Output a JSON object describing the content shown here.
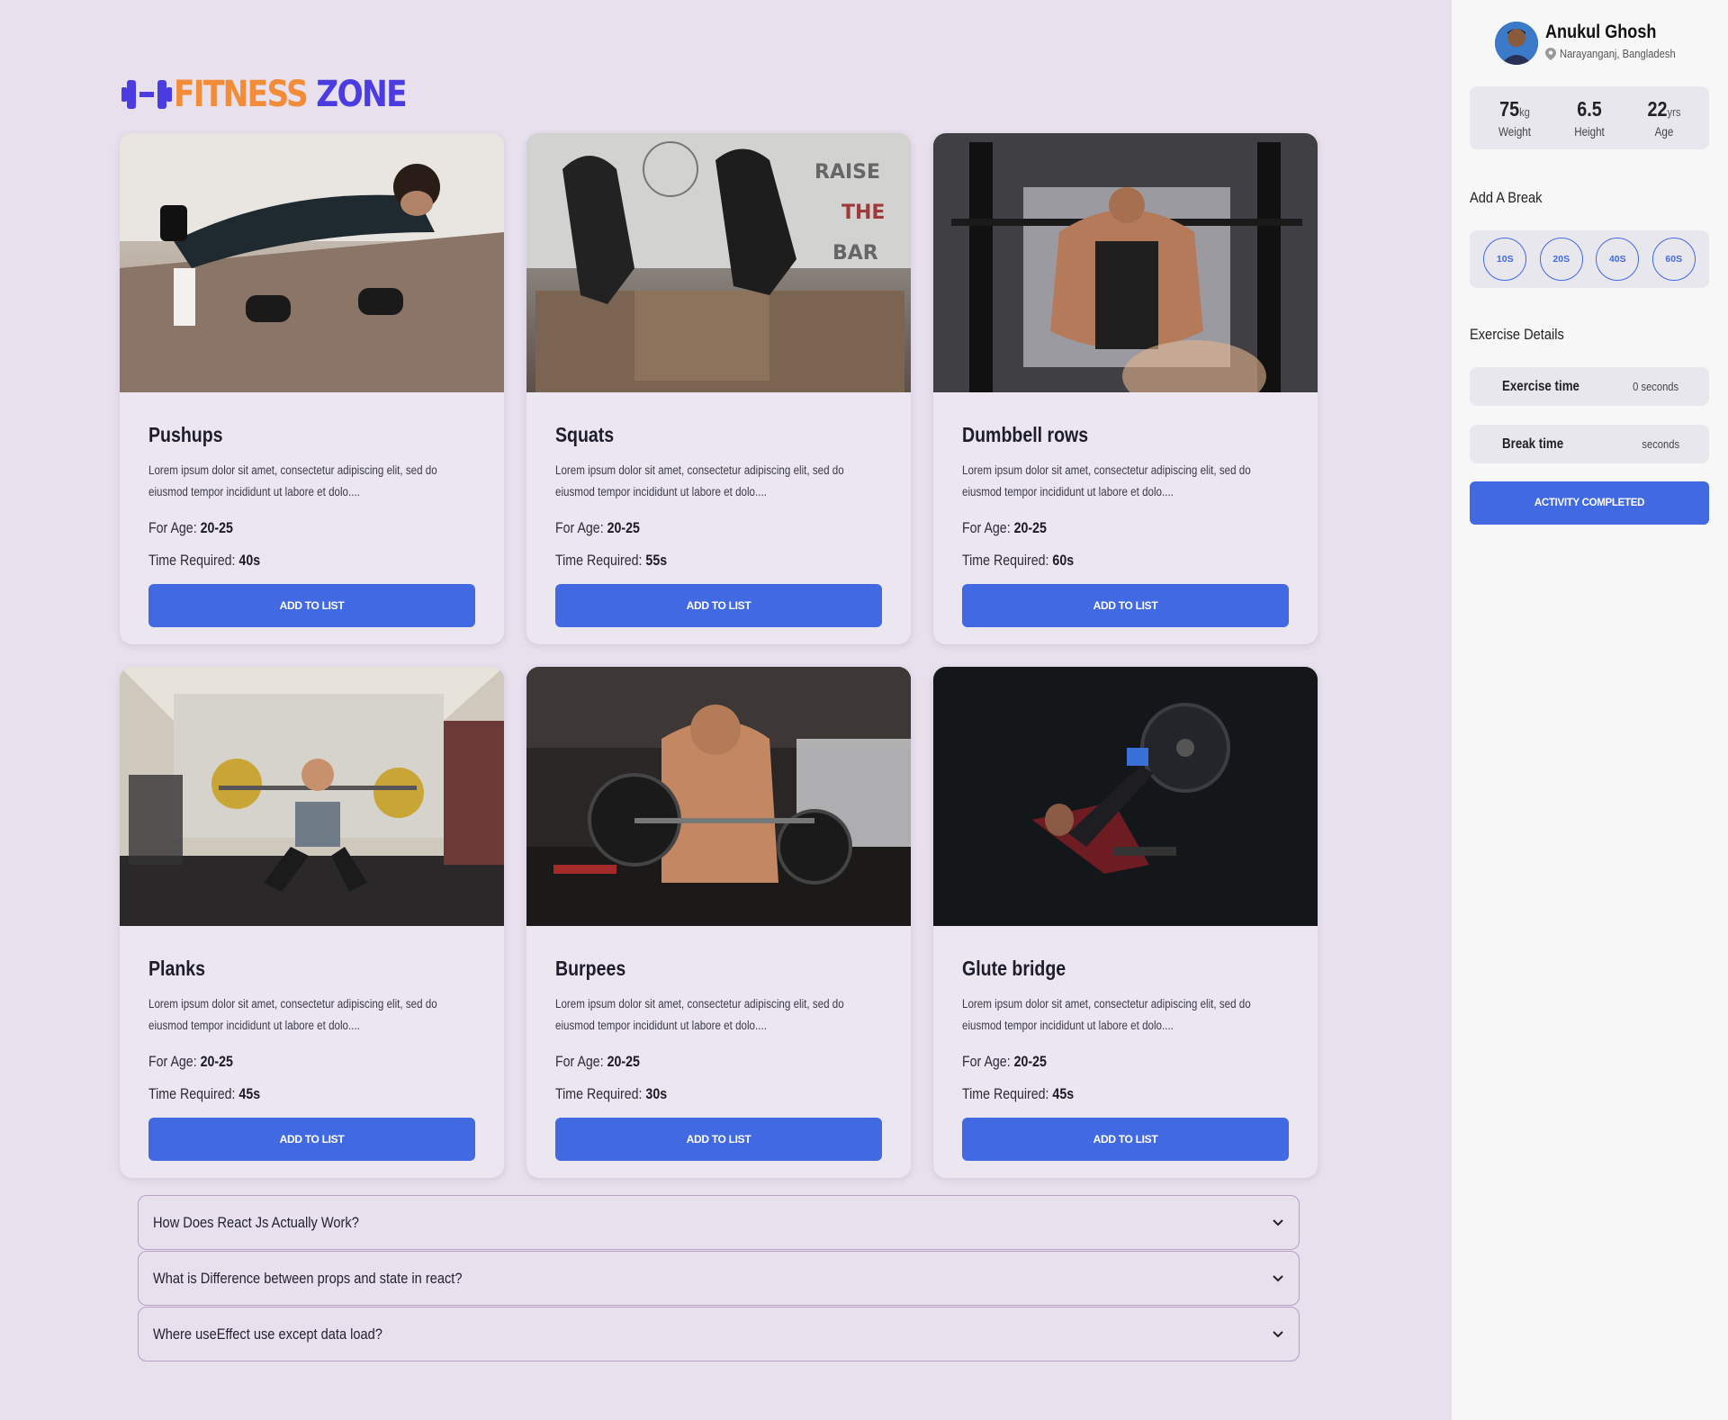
{
  "brand": {
    "part1": "FITNESS",
    "part2": "ZONE"
  },
  "colors": {
    "accent": "#4169e1",
    "brand_orange": "#f28c38",
    "brand_purple": "#4a3ce0"
  },
  "labels": {
    "for_age": "For Age:",
    "time_required": "Time Required:",
    "add_button": "ADD TO LIST"
  },
  "cards": [
    {
      "title": "Pushups",
      "desc": "Lorem ipsum dolor sit amet, consectetur adipiscing elit, sed do eiusmod tempor incididunt ut labore et dolo....",
      "age": "20-25",
      "time": "40s"
    },
    {
      "title": "Squats",
      "desc": "Lorem ipsum dolor sit amet, consectetur adipiscing elit, sed do eiusmod tempor incididunt ut labore et dolo....",
      "age": "20-25",
      "time": "55s"
    },
    {
      "title": "Dumbbell rows",
      "desc": "Lorem ipsum dolor sit amet, consectetur adipiscing elit, sed do eiusmod tempor incididunt ut labore et dolo....",
      "age": "20-25",
      "time": "60s"
    },
    {
      "title": "Planks",
      "desc": "Lorem ipsum dolor sit amet, consectetur adipiscing elit, sed do eiusmod tempor incididunt ut labore et dolo....",
      "age": "20-25",
      "time": "45s"
    },
    {
      "title": "Burpees",
      "desc": "Lorem ipsum dolor sit amet, consectetur adipiscing elit, sed do eiusmod tempor incididunt ut labore et dolo....",
      "age": "20-25",
      "time": "30s"
    },
    {
      "title": "Glute bridge",
      "desc": "Lorem ipsum dolor sit amet, consectetur adipiscing elit, sed do eiusmod tempor incididunt ut labore et dolo....",
      "age": "20-25",
      "time": "45s"
    }
  ],
  "faq": [
    {
      "q": "How Does React Js Actually Work?"
    },
    {
      "q": "What is Difference between props and state in react?"
    },
    {
      "q": "Where useEffect use except data load?"
    }
  ],
  "sidebar": {
    "name": "Anukul Ghosh",
    "location": "Narayanganj, Bangladesh",
    "stats": [
      {
        "value": "75",
        "unit": "kg",
        "label": "Weight"
      },
      {
        "value": "6.5",
        "unit": "",
        "label": "Height"
      },
      {
        "value": "22",
        "unit": "yrs",
        "label": "Age"
      }
    ],
    "break_title": "Add A Break",
    "breaks": [
      "10S",
      "20S",
      "40S",
      "60S"
    ],
    "details_title": "Exercise Details",
    "exercise_time_label": "Exercise time",
    "exercise_time_value": "0 seconds",
    "break_time_label": "Break time",
    "break_time_value": "seconds",
    "complete_label": "ACTIVITY COMPLETED"
  }
}
